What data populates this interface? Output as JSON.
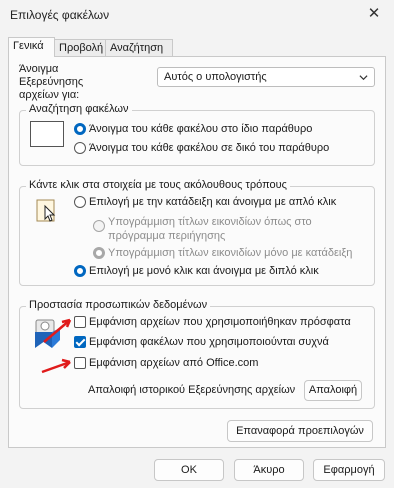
{
  "window": {
    "title": "Επιλογές φακέλων",
    "close_glyph": "✕"
  },
  "tabs": [
    {
      "label": "Γενικά",
      "active": true
    },
    {
      "label": "Προβολή",
      "active": false
    },
    {
      "label": "Αναζήτηση",
      "active": false
    }
  ],
  "open_explorer": {
    "label_line1": "Άνοιγμα",
    "label_line2": "Εξερεύνησης",
    "label_line3": "αρχείων για:",
    "selected": "Αυτός ο υπολογιστής"
  },
  "browse_folders": {
    "legend": "Αναζήτηση φακέλων",
    "option1": "Άνοιγμα του κάθε φακέλου στο ίδιο παράθυρο",
    "option2": "Άνοιγμα του κάθε φακέλου σε δικό του παράθυρο",
    "selected_index": 0
  },
  "click_items": {
    "legend": "Κάντε κλικ στα στοιχεία με τους ακόλουθους τρόπους",
    "option_single": "Επιλογή με την κατάδειξη και άνοιγμα με απλό κλικ",
    "sub1_line1": "Υπογράμμιση τίτλων εικονιδίων όπως στο",
    "sub1_line2": "πρόγραμμα περιήγησης",
    "sub2": "Υπογράμμιση τίτλων εικονιδίων μόνο με κατάδειξη",
    "option_double": "Επιλογή με μονό κλικ και άνοιγμα με διπλό κλικ",
    "selected": "double"
  },
  "privacy": {
    "legend": "Προστασία προσωπικών δεδομένων",
    "cb1": {
      "label": "Εμφάνιση αρχείων που χρησιμοποιήθηκαν πρόσφατα",
      "checked": false
    },
    "cb2": {
      "label": "Εμφάνιση φακέλων που χρησιμοποιούνται συχνά",
      "checked": true
    },
    "cb3": {
      "label": "Εμφάνιση αρχείων από Office.com",
      "checked": false
    },
    "clear_label": "Απαλοιφή ιστορικού Εξερεύνησης αρχείων",
    "clear_button": "Απαλοιφή"
  },
  "restore_button": "Επαναφορά προεπιλογών",
  "footer": {
    "ok": "OK",
    "cancel": "Άκυρο",
    "apply": "Εφαρμογή"
  },
  "colors": {
    "accent": "#0067c0",
    "annotation_arrow": "#e01b1b"
  }
}
